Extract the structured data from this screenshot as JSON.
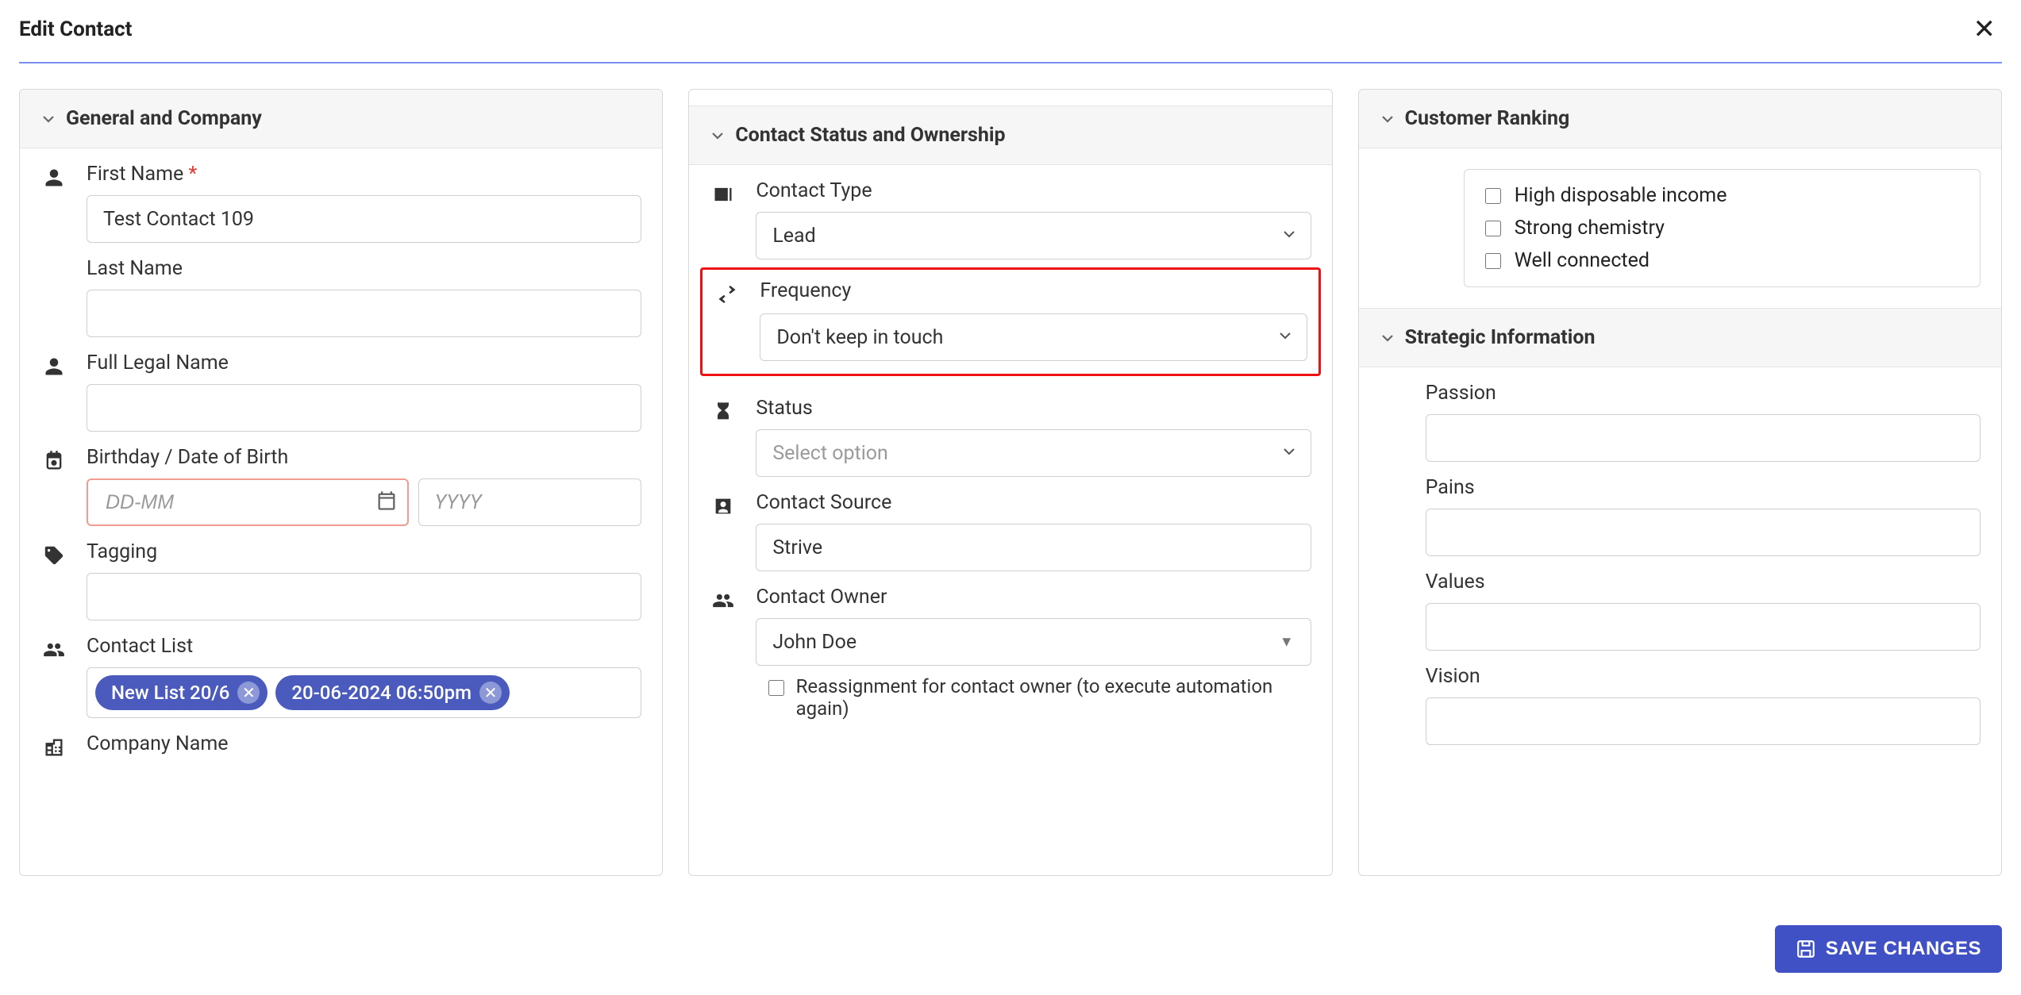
{
  "header": {
    "title": "Edit Contact"
  },
  "save_button_label": "SAVE CHANGES",
  "col1": {
    "section_title": "General and Company",
    "first_name_label": "First Name",
    "first_name_value": "Test Contact 109",
    "last_name_label": "Last Name",
    "last_name_value": "",
    "full_legal_label": "Full Legal Name",
    "full_legal_value": "",
    "dob_label": "Birthday / Date of Birth",
    "dob_dm_placeholder": "DD-MM",
    "dob_y_placeholder": "YYYY",
    "tagging_label": "Tagging",
    "contact_list_label": "Contact List",
    "chips": [
      {
        "label": "New List 20/6"
      },
      {
        "label": "20-06-2024 06:50pm"
      }
    ],
    "company_name_label": "Company Name"
  },
  "col2": {
    "section_title": "Contact Status and Ownership",
    "contact_type_label": "Contact Type",
    "contact_type_value": "Lead",
    "frequency_label": "Frequency",
    "frequency_value": "Don't keep in touch",
    "status_label": "Status",
    "status_placeholder": "Select option",
    "contact_source_label": "Contact Source",
    "contact_source_value": "Strive",
    "contact_owner_label": "Contact Owner",
    "contact_owner_value": "John Doe",
    "reassign_label": "Reassignment for contact owner (to execute automation again)"
  },
  "col3": {
    "ranking_title": "Customer Ranking",
    "ranking_items": [
      "High disposable income",
      "Strong chemistry",
      "Well connected"
    ],
    "strategic_title": "Strategic Information",
    "passion_label": "Passion",
    "pains_label": "Pains",
    "values_label": "Values",
    "vision_label": "Vision"
  }
}
